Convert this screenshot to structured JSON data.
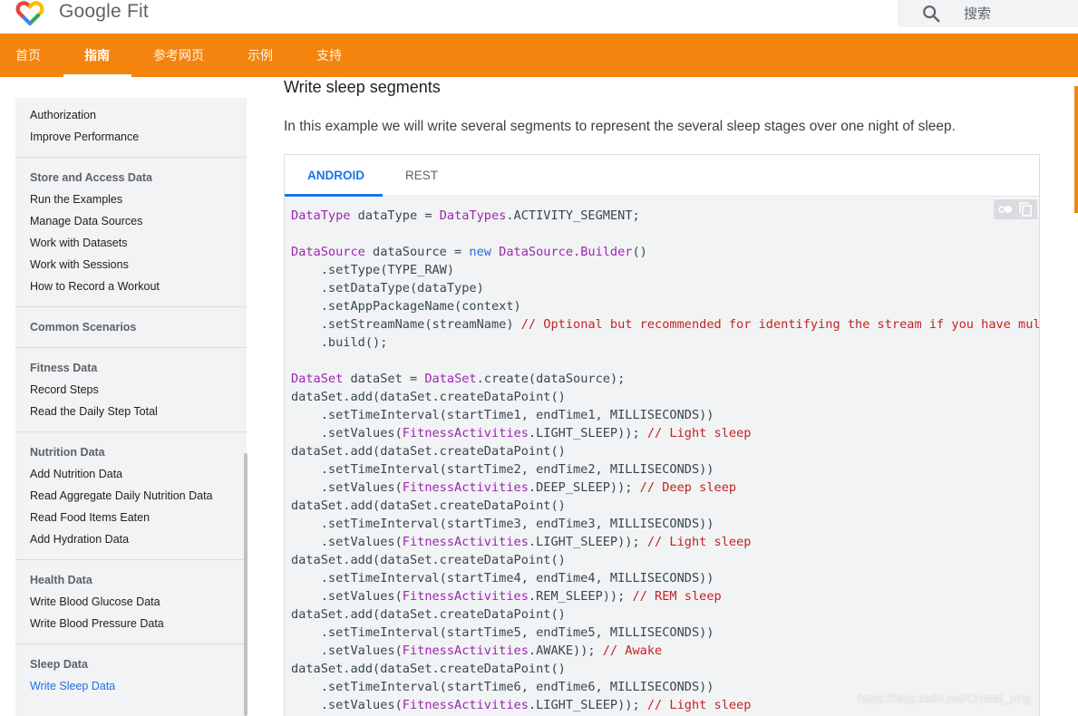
{
  "header": {
    "product_name": "Google Fit",
    "search_placeholder": "搜索",
    "colors": {
      "brand_orange": "#f4840e",
      "link_blue": "#1a73e8"
    }
  },
  "nav": {
    "tabs": [
      {
        "label": "首页"
      },
      {
        "label": "指南",
        "active": true
      },
      {
        "label": "参考网页"
      },
      {
        "label": "示例"
      },
      {
        "label": "支持"
      }
    ]
  },
  "sidebar": {
    "sections": [
      {
        "heading": "",
        "items": [
          "Authorization",
          "Improve Performance"
        ]
      },
      {
        "heading": "Store and Access Data",
        "items": [
          "Run the Examples",
          "Manage Data Sources",
          "Work with Datasets",
          "Work with Sessions",
          "How to Record a Workout"
        ]
      },
      {
        "heading": "Common Scenarios",
        "items": []
      },
      {
        "heading": "Fitness Data",
        "items": [
          "Record Steps",
          "Read the Daily Step Total"
        ]
      },
      {
        "heading": "Nutrition Data",
        "items": [
          "Add Nutrition Data",
          "Read Aggregate Daily Nutrition Data",
          "Read Food Items Eaten",
          "Add Hydration Data"
        ]
      },
      {
        "heading": "Health Data",
        "items": [
          "Write Blood Glucose Data",
          "Write Blood Pressure Data"
        ]
      },
      {
        "heading": "Sleep Data",
        "items": [
          "Write Sleep Data"
        ]
      }
    ],
    "current_item": "Write Sleep Data"
  },
  "main": {
    "section_title": "Write sleep segments",
    "intro": "In this example we will write several segments to represent the several sleep stages over one night of sleep.",
    "code_tabs": [
      {
        "label": "ANDROID",
        "active": true
      },
      {
        "label": "REST"
      }
    ],
    "code_lines": [
      [
        [
          "t",
          "DataType"
        ],
        [
          "p",
          " dataType = "
        ],
        [
          "t",
          "DataTypes"
        ],
        [
          "p",
          ".ACTIVITY_SEGMENT;"
        ]
      ],
      [],
      [
        [
          "t",
          "DataSource"
        ],
        [
          "p",
          " dataSource = "
        ],
        [
          "k",
          "new"
        ],
        [
          "p",
          " "
        ],
        [
          "t",
          "DataSource.Builder"
        ],
        [
          "p",
          "()"
        ]
      ],
      [
        [
          "p",
          "    .setType(TYPE_RAW)"
        ]
      ],
      [
        [
          "p",
          "    .setDataType(dataType)"
        ]
      ],
      [
        [
          "p",
          "    .setAppPackageName(context)"
        ]
      ],
      [
        [
          "p",
          "    .setStreamName(streamName) "
        ],
        [
          "c",
          "// Optional but recommended for identifying the stream if you have multiple"
        ]
      ],
      [
        [
          "p",
          "    .build();"
        ]
      ],
      [],
      [
        [
          "t",
          "DataSet"
        ],
        [
          "p",
          " dataSet = "
        ],
        [
          "t",
          "DataSet"
        ],
        [
          "p",
          ".create(dataSource);"
        ]
      ],
      [
        [
          "p",
          "dataSet.add(dataSet.createDataPoint()"
        ]
      ],
      [
        [
          "p",
          "    .setTimeInterval(startTime1, endTime1, MILLISECONDS))"
        ]
      ],
      [
        [
          "p",
          "    .setValues("
        ],
        [
          "t",
          "FitnessActivities"
        ],
        [
          "p",
          ".LIGHT_SLEEP)); "
        ],
        [
          "c",
          "// Light sleep"
        ]
      ],
      [
        [
          "p",
          "dataSet.add(dataSet.createDataPoint()"
        ]
      ],
      [
        [
          "p",
          "    .setTimeInterval(startTime2, endTime2, MILLISECONDS))"
        ]
      ],
      [
        [
          "p",
          "    .setValues("
        ],
        [
          "t",
          "FitnessActivities"
        ],
        [
          "p",
          ".DEEP_SLEEP)); "
        ],
        [
          "c",
          "// Deep sleep"
        ]
      ],
      [
        [
          "p",
          "dataSet.add(dataSet.createDataPoint()"
        ]
      ],
      [
        [
          "p",
          "    .setTimeInterval(startTime3, endTime3, MILLISECONDS))"
        ]
      ],
      [
        [
          "p",
          "    .setValues("
        ],
        [
          "t",
          "FitnessActivities"
        ],
        [
          "p",
          ".LIGHT_SLEEP)); "
        ],
        [
          "c",
          "// Light sleep"
        ]
      ],
      [
        [
          "p",
          "dataSet.add(dataSet.createDataPoint()"
        ]
      ],
      [
        [
          "p",
          "    .setTimeInterval(startTime4, endTime4, MILLISECONDS))"
        ]
      ],
      [
        [
          "p",
          "    .setValues("
        ],
        [
          "t",
          "FitnessActivities"
        ],
        [
          "p",
          ".REM_SLEEP)); "
        ],
        [
          "c",
          "// REM sleep"
        ]
      ],
      [
        [
          "p",
          "dataSet.add(dataSet.createDataPoint()"
        ]
      ],
      [
        [
          "p",
          "    .setTimeInterval(startTime5, endTime5, MILLISECONDS))"
        ]
      ],
      [
        [
          "p",
          "    .setValues("
        ],
        [
          "t",
          "FitnessActivities"
        ],
        [
          "p",
          ".AWAKE)); "
        ],
        [
          "c",
          "// Awake"
        ]
      ],
      [
        [
          "p",
          "dataSet.add(dataSet.createDataPoint()"
        ]
      ],
      [
        [
          "p",
          "    .setTimeInterval(startTime6, endTime6, MILLISECONDS))"
        ]
      ],
      [
        [
          "p",
          "    .setValues("
        ],
        [
          "t",
          "FitnessActivities"
        ],
        [
          "p",
          ".LIGHT_SLEEP)); "
        ],
        [
          "c",
          "// Light sleep"
        ]
      ]
    ]
  },
  "watermark": "https://blog.csdn.net/Crystal_xing"
}
